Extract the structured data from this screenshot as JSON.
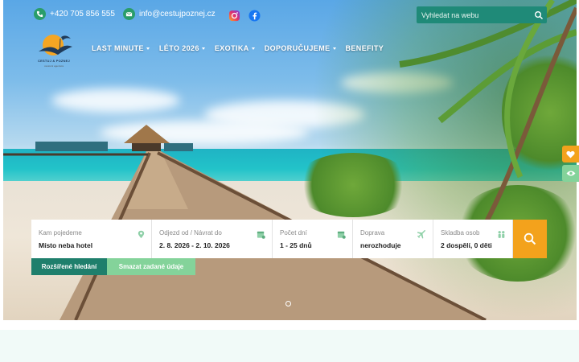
{
  "header": {
    "phone": "+420 705 856 555",
    "email": "info@cestujpoznej.cz",
    "social": [
      "instagram-icon",
      "facebook-icon"
    ],
    "search": {
      "placeholder": "Vyhledat na webu"
    }
  },
  "logo": {
    "line1": "CESTUJ & POZNEJ",
    "line2": "cestovní agentura"
  },
  "nav": [
    {
      "label": "LAST MINUTE",
      "dropdown": true
    },
    {
      "label": "LÉTO 2026",
      "dropdown": true
    },
    {
      "label": "EXOTIKA",
      "dropdown": true
    },
    {
      "label": "DOPORUČUJEME",
      "dropdown": true
    },
    {
      "label": "BENEFITY",
      "dropdown": false
    }
  ],
  "search_form": {
    "fields": [
      {
        "label": "Kam pojedeme",
        "value": "Místo neba hotel",
        "icon": "location-pin-icon"
      },
      {
        "label": "Odjezd od / Návrat do",
        "value": "2. 8. 2026 - 2. 10. 2026",
        "icon": "calendar-icon"
      },
      {
        "label": "Počet dní",
        "value": "1 - 25 dnů",
        "icon": "calendar-days-icon"
      },
      {
        "label": "Doprava",
        "value": "nerozhoduje",
        "icon": "plane-icon"
      },
      {
        "label": "Skladba osob",
        "value": "2 dospělí, 0 děti",
        "icon": "people-icon"
      }
    ],
    "advanced_label": "Rozšířené hledání",
    "clear_label": "Smazat zadané údaje"
  },
  "colors": {
    "accent": "#f3a21c",
    "primary": "#1f7f6c",
    "light_green": "#84d39a"
  },
  "side_tabs": [
    "heart-icon",
    "eye-icon"
  ]
}
